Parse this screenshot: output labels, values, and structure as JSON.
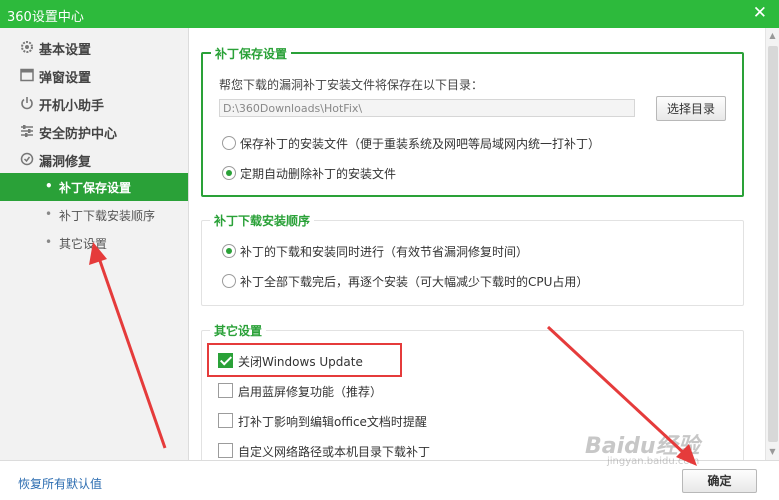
{
  "window": {
    "title": "360设置中心",
    "close_symbol": "✕"
  },
  "sidebar": {
    "items": [
      {
        "label": "基本设置",
        "icon": "gear-icon"
      },
      {
        "label": "弹窗设置",
        "icon": "window-icon"
      },
      {
        "label": "开机小助手",
        "icon": "power-icon"
      },
      {
        "label": "安全防护中心",
        "icon": "sliders-icon"
      },
      {
        "label": "漏洞修复",
        "icon": "shield-repair-icon"
      }
    ],
    "subitems": [
      {
        "label": "补丁保存设置",
        "active": true
      },
      {
        "label": "补丁下载安装顺序",
        "active": false
      },
      {
        "label": "其它设置",
        "active": false
      }
    ],
    "bullet": "•"
  },
  "patch_save": {
    "title": "补丁保存设置",
    "description": "帮您下载的漏洞补丁安装文件将保存在以下目录：",
    "path_value": "D:\\360Downloads\\HotFix\\",
    "choose_button": "选择目录",
    "options": [
      {
        "label": "保存补丁的安装文件（便于重装系统及网吧等局域网内统一打补丁）",
        "selected": false
      },
      {
        "label": "定期自动删除补丁的安装文件",
        "selected": true
      }
    ]
  },
  "install_order": {
    "title": "补丁下载安装顺序",
    "options": [
      {
        "label": "补丁的下载和安装同时进行（有效节省漏洞修复时间）",
        "selected": true
      },
      {
        "label": "补丁全部下载完后，再逐个安装（可大幅减少下载时的CPU占用）",
        "selected": false
      }
    ]
  },
  "other": {
    "title": "其它设置",
    "options": [
      {
        "label": "关闭Windows Update",
        "checked": true
      },
      {
        "label": "启用蓝屏修复功能（推荐）",
        "checked": false
      },
      {
        "label": "打补丁影响到编辑office文档时提醒",
        "checked": false
      },
      {
        "label": "自定义网络路径或本机目录下载补丁",
        "checked": false
      }
    ]
  },
  "footer": {
    "restore_label": "恢复所有默认值",
    "ok_label": "确定"
  },
  "watermark": {
    "main": "Baidu经验",
    "sub": "jingyan.baidu.com"
  },
  "colors": {
    "accent": "#2aa138",
    "titlebar": "#2dba3c",
    "annotation": "#e53b3b",
    "link": "#2b6cb0"
  }
}
